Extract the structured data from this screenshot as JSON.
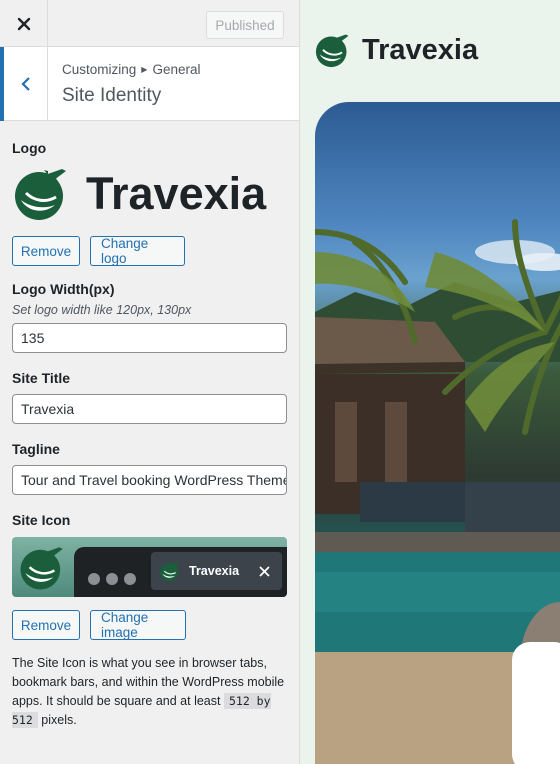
{
  "topbar": {
    "close_icon": "close-icon",
    "publish_label": "Published"
  },
  "section": {
    "breadcrumb_parent": "Customizing",
    "breadcrumb_current": "General",
    "title": "Site Identity",
    "back_icon": "chevron-left-icon"
  },
  "logo": {
    "label": "Logo",
    "wordmark": "Travexia",
    "remove_label": "Remove",
    "change_label": "Change logo"
  },
  "logo_width": {
    "label": "Logo Width(px)",
    "description": "Set logo width like 120px, 130px",
    "value": "135"
  },
  "site_title": {
    "label": "Site Title",
    "value": "Travexia"
  },
  "tagline": {
    "label": "Tagline",
    "value": "Tour and Travel booking WordPress Theme"
  },
  "site_icon": {
    "label": "Site Icon",
    "tab_title": "Travexia",
    "remove_label": "Remove",
    "change_label": "Change image",
    "help_text_1": "The Site Icon is what you see in browser tabs, bookmark bars, and within the WordPress mobile apps. It should be square and at least",
    "size_code": "512 by 512",
    "help_text_2": "pixels."
  },
  "preview": {
    "site_name": "Travexia"
  },
  "colors": {
    "accent": "#2271b1",
    "brand_green": "#1b5e3c"
  }
}
